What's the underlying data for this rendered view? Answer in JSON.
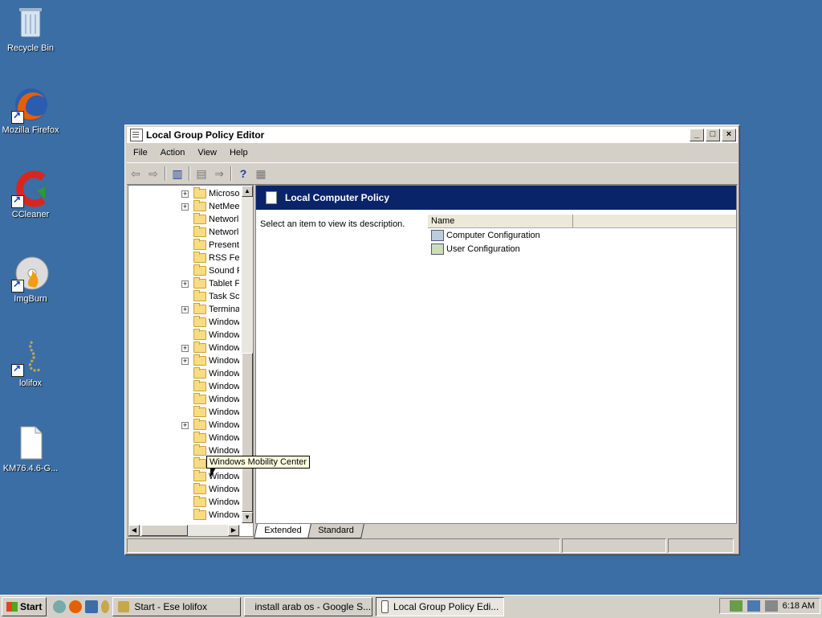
{
  "desktop": {
    "icons": [
      {
        "label": "Recycle Bin"
      },
      {
        "label": "Mozilla Firefox"
      },
      {
        "label": "CCleaner"
      },
      {
        "label": "ImgBurn"
      },
      {
        "label": "lolifox"
      },
      {
        "label": "KM76.4.6-G..."
      }
    ]
  },
  "window": {
    "title": "Local Group Policy Editor",
    "buttons": {
      "minimize": "_",
      "maximize": "□",
      "close": "×"
    },
    "menu": [
      "File",
      "Action",
      "View",
      "Help"
    ],
    "tree": {
      "items": [
        {
          "label": "Microso",
          "expandable": true
        },
        {
          "label": "NetMee",
          "expandable": true
        },
        {
          "label": "Networl",
          "expandable": false
        },
        {
          "label": "Networl",
          "expandable": false
        },
        {
          "label": "Present",
          "expandable": false
        },
        {
          "label": "RSS Fee",
          "expandable": false
        },
        {
          "label": "Sound R",
          "expandable": false
        },
        {
          "label": "Tablet F",
          "expandable": true
        },
        {
          "label": "Task Sc",
          "expandable": false
        },
        {
          "label": "Termina",
          "expandable": true
        },
        {
          "label": "Window",
          "expandable": false
        },
        {
          "label": "Window",
          "expandable": false
        },
        {
          "label": "Window",
          "expandable": true
        },
        {
          "label": "Window",
          "expandable": true
        },
        {
          "label": "Window",
          "expandable": false
        },
        {
          "label": "Window",
          "expandable": false
        },
        {
          "label": "Window",
          "expandable": false
        },
        {
          "label": "Window",
          "expandable": false
        },
        {
          "label": "Window",
          "expandable": true
        },
        {
          "label": "Window",
          "expandable": false
        },
        {
          "label": "Window",
          "expandable": false
        },
        {
          "label": "",
          "expandable": false
        },
        {
          "label": "Window",
          "expandable": false
        },
        {
          "label": "Window",
          "expandable": false
        },
        {
          "label": "Window",
          "expandable": false
        },
        {
          "label": "Window",
          "expandable": false
        }
      ]
    },
    "pane": {
      "heading": "Local Computer Policy",
      "description": "Select an item to view its description.",
      "column_name": "Name",
      "items": [
        "Computer Configuration",
        "User Configuration"
      ]
    },
    "tabs": [
      "Extended",
      "Standard"
    ],
    "tooltip": "Windows Mobility Center"
  },
  "taskbar": {
    "start_label": "Start",
    "tasks": [
      {
        "label": "Start - Ese lolifox",
        "active": false
      },
      {
        "label": "install arab os - Google S...",
        "active": false
      },
      {
        "label": "Local Group Policy Edi...",
        "active": true
      }
    ],
    "clock": "6:18 AM"
  },
  "colors": {
    "desktop": "#3a6ea5",
    "header_band": "#0a246a",
    "folder": "#f7dc83",
    "tooltip_bg": "#ffffe1"
  }
}
